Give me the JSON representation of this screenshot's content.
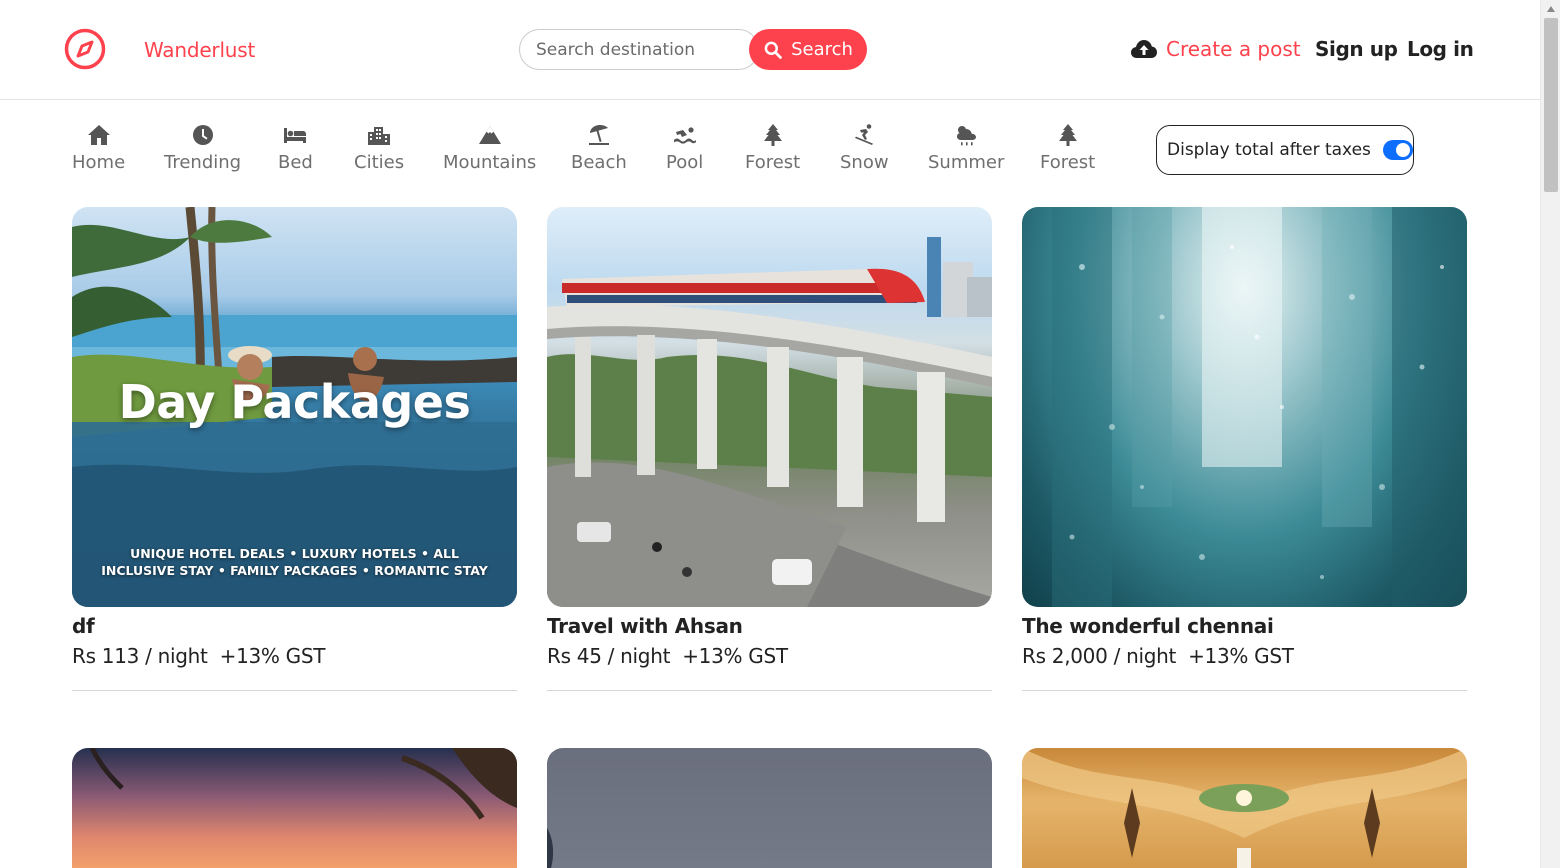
{
  "brand": {
    "name": "Wanderlust",
    "accent": "#fe424d"
  },
  "search": {
    "placeholder": "Search destination",
    "button_label": "Search"
  },
  "nav": {
    "create_post": "Create a post",
    "signup": "Sign up",
    "login": "Log in"
  },
  "filters": [
    {
      "label": "Home",
      "icon": "home-icon"
    },
    {
      "label": "Trending",
      "icon": "clock-icon"
    },
    {
      "label": "Bed",
      "icon": "bed-icon"
    },
    {
      "label": "Cities",
      "icon": "city-icon"
    },
    {
      "label": "Mountains",
      "icon": "mountain-icon"
    },
    {
      "label": "Beach",
      "icon": "umbrella-beach-icon"
    },
    {
      "label": "Pool",
      "icon": "swimmer-icon"
    },
    {
      "label": "Forest",
      "icon": "tree-icon"
    },
    {
      "label": "Snow",
      "icon": "skier-icon"
    },
    {
      "label": "Summer",
      "icon": "cloud-sun-rain-icon"
    },
    {
      "label": "Forest",
      "icon": "tree-icon"
    }
  ],
  "tax_toggle": {
    "label": "Display total after taxes",
    "enabled": true,
    "color": "#0d6efd"
  },
  "listings": [
    {
      "title": "df",
      "price": "Rs 113 / night",
      "tax": "+13% GST",
      "image_text": {
        "headline": "Day Packages",
        "tagline": "UNIQUE HOTEL DEALS • LUXURY HOTELS • ALL INCLUSIVE STAY • FAMILY PACKAGES • ROMANTIC STAY"
      }
    },
    {
      "title": "Travel with Ahsan",
      "price": "Rs 45 / night",
      "tax": "+13% GST"
    },
    {
      "title": "The wonderful chennai",
      "price": "Rs 2,000 / night",
      "tax": "+13% GST"
    }
  ]
}
